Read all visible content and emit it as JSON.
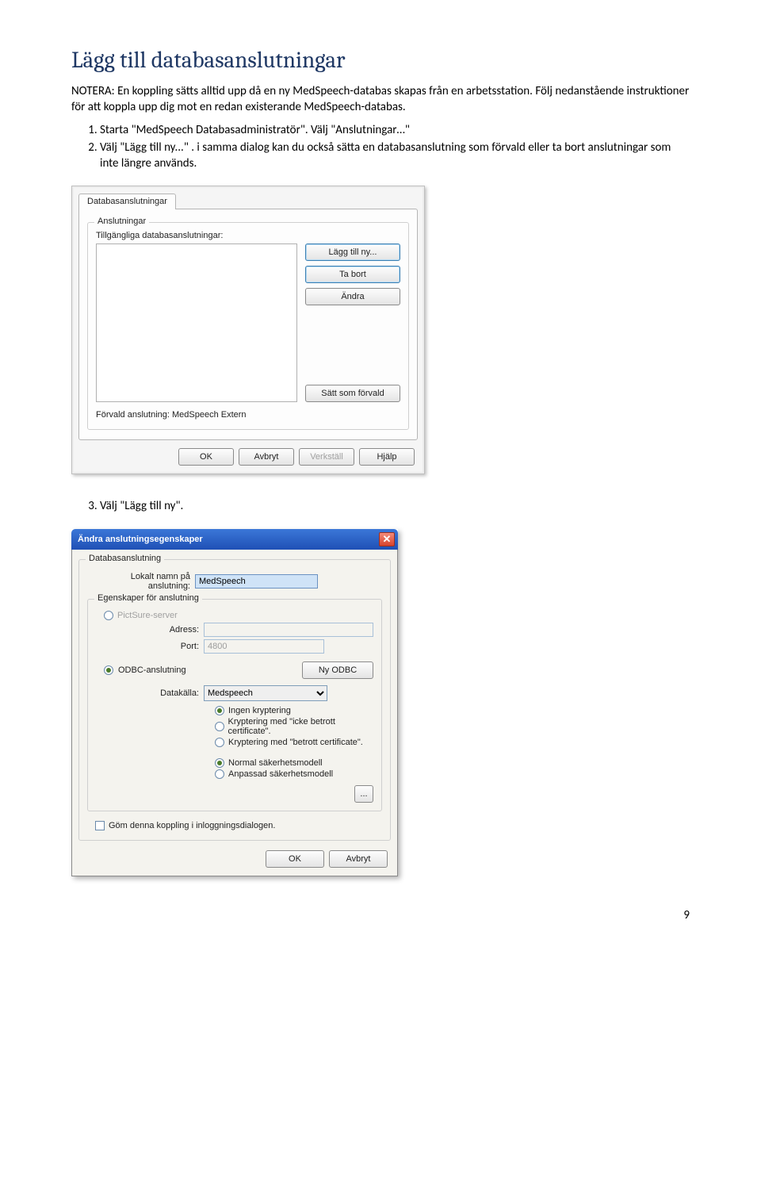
{
  "heading": "Lägg till databasanslutningar",
  "intro": "NOTERA: En koppling sätts alltid upp då en ny MedSpeech-databas skapas från en arbetsstation. Följ nedanstående instruktioner för att koppla upp dig mot en redan existerande MedSpeech-databas.",
  "steps1": [
    "Starta \"MedSpeech Databasadministratör\". Välj \"Anslutningar…\"",
    "Välj \"Lägg till ny...\" . i samma dialog kan du också sätta en databasanslutning som förvald eller ta bort anslutningar som inte längre används."
  ],
  "dialog1": {
    "tab": "Databasanslutningar",
    "fieldset": "Anslutningar",
    "list_label": "Tillgängliga databasanslutningar:",
    "buttons": {
      "add": "Lägg till ny...",
      "remove": "Ta bort",
      "edit": "Ändra",
      "set_default": "Sätt som förvald"
    },
    "status": "Förvald anslutning: MedSpeech Extern",
    "footer": {
      "ok": "OK",
      "cancel": "Avbryt",
      "apply": "Verkställ",
      "help": "Hjälp"
    }
  },
  "step3": "Välj \"Lägg till ny\".",
  "dialog2": {
    "title": "Ändra anslutningsegenskaper",
    "fs_conn": "Databasanslutning",
    "local_name_label": "Lokalt namn på anslutning:",
    "local_name_value": "MedSpeech",
    "fs_props": "Egenskaper för anslutning",
    "pictsure_radio": "PictSure-server",
    "address_label": "Adress:",
    "port_label": "Port:",
    "port_value": "4800",
    "odbc_radio": "ODBC-anslutning",
    "new_odbc_btn": "Ny ODBC",
    "datasource_label": "Datakälla:",
    "datasource_value": "Medspeech",
    "crypt": [
      "Ingen kryptering",
      "Kryptering med \"icke betrott certificate\".",
      "Kryptering med \"betrott certificate\"."
    ],
    "security": [
      "Normal säkerhetsmodell",
      "Anpassad säkerhetsmodell"
    ],
    "ellipsis": "...",
    "hide_check": "Göm denna koppling i inloggningsdialogen.",
    "footer": {
      "ok": "OK",
      "cancel": "Avbryt"
    }
  },
  "pagenum": "9"
}
